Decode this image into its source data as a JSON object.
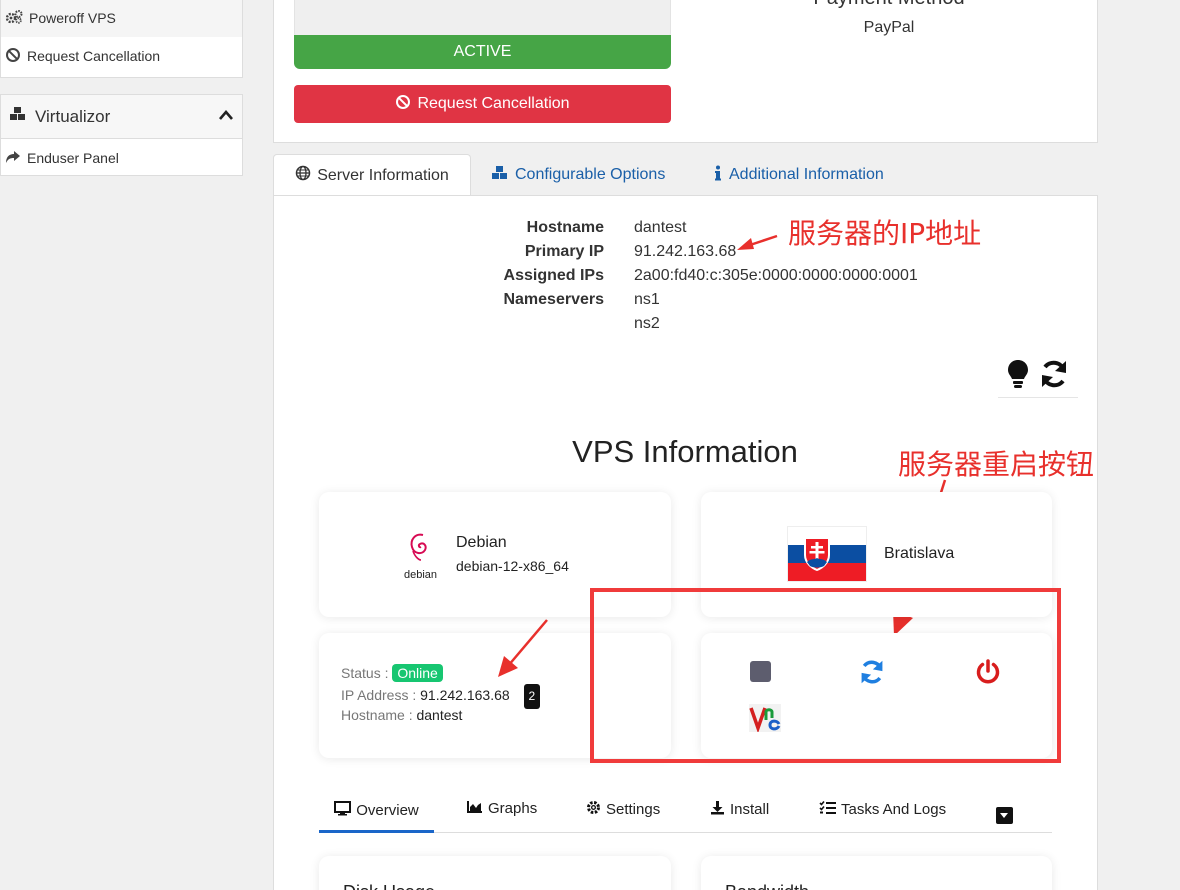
{
  "sidebar": {
    "actions": [
      {
        "label": "Poweroff VPS",
        "icon": "gears-icon"
      },
      {
        "label": "Request Cancellation",
        "icon": "ban-icon"
      }
    ],
    "virtualizor": {
      "title": "Virtualizor",
      "items": [
        {
          "label": "Enduser Panel",
          "icon": "share-icon"
        }
      ]
    }
  },
  "product": {
    "status_label": "ACTIVE",
    "cancel_button": "Request Cancellation",
    "payment_method_title": "Payment Method",
    "payment_method": "PayPal"
  },
  "tabs": [
    {
      "label": "Server Information",
      "icon": "globe-icon",
      "active": true
    },
    {
      "label": "Configurable Options",
      "icon": "cubes-icon"
    },
    {
      "label": "Additional Information",
      "icon": "info-icon"
    }
  ],
  "server_info": {
    "labels": [
      "Hostname",
      "Primary IP",
      "Assigned IPs",
      "Nameservers"
    ],
    "hostname": "dantest",
    "primary_ip": "91.242.163.68",
    "assigned_ips": "2a00:fd40:c:305e:0000:0000:0000:0001",
    "nameservers": [
      "ns1",
      "ns2"
    ]
  },
  "annotations": {
    "ip_note": "服务器的IP地址",
    "reboot_note": "服务器重启按钮"
  },
  "vps": {
    "title": "VPS Information",
    "os_name": "Debian",
    "os_version": "debian-12-x86_64",
    "os_logo_text": "debian",
    "location": "Bratislava",
    "status_label": "Status :",
    "status": "Online",
    "ip_label": "IP Address :",
    "ip": "91.242.163.68",
    "ip_count": "2",
    "hostname_label": "Hostname :",
    "hostname": "dantest"
  },
  "subnav": {
    "items": [
      "Overview",
      "Graphs",
      "Settings",
      "Install",
      "Tasks And Logs"
    ]
  },
  "bottom_cards": {
    "disk": "Disk Usage",
    "bandwidth": "Bandwidth"
  },
  "colors": {
    "active_green": "#46a546",
    "cancel_red": "#e03444",
    "link_blue": "#1a5fa8",
    "online_green": "#17c671",
    "annotation_red": "#e8302c"
  }
}
